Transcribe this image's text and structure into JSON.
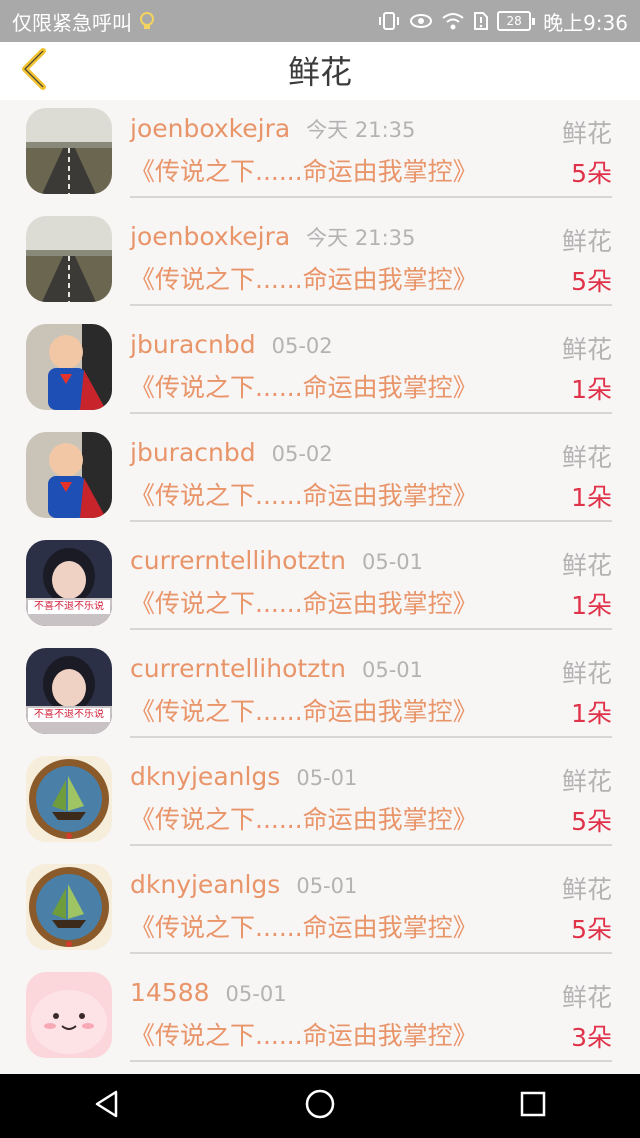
{
  "status_bar": {
    "carrier": "仅限紧急呼叫",
    "battery": "28",
    "time": "晚上9:36",
    "icons": [
      "lightbulb-icon",
      "vibrate-icon",
      "eye-icon",
      "wifi-icon",
      "sim-alert-icon",
      "battery-icon"
    ]
  },
  "header": {
    "title": "鲜花",
    "back_icon": "chevron-left-icon",
    "accent": "#f2c12e"
  },
  "colors": {
    "username": "#e9956a",
    "meta": "#b3b3b3",
    "count": "#e0334a"
  },
  "items": [
    {
      "user": "joenboxkejra",
      "time": "今天 21:35",
      "label": "鲜花",
      "book": "《传说之下......命运由我掌控》",
      "count": "5朵",
      "avatar": "road-photo"
    },
    {
      "user": "joenboxkejra",
      "time": "今天 21:35",
      "label": "鲜花",
      "book": "《传说之下......命运由我掌控》",
      "count": "5朵",
      "avatar": "road-photo"
    },
    {
      "user": "jburacnbd",
      "time": "05-02",
      "label": "鲜花",
      "book": "《传说之下......命运由我掌控》",
      "count": "1朵",
      "avatar": "superman-baby-photo"
    },
    {
      "user": "jburacnbd",
      "time": "05-02",
      "label": "鲜花",
      "book": "《传说之下......命运由我掌控》",
      "count": "1朵",
      "avatar": "superman-baby-photo"
    },
    {
      "user": "currerntellihotztn",
      "time": "05-01",
      "label": "鲜花",
      "book": "《传说之下......命运由我掌控》",
      "count": "1朵",
      "avatar": "girl-photo"
    },
    {
      "user": "currerntellihotztn",
      "time": "05-01",
      "label": "鲜花",
      "book": "《传说之下......命运由我掌控》",
      "count": "1朵",
      "avatar": "girl-photo"
    },
    {
      "user": "dknyjeanlgs",
      "time": "05-01",
      "label": "鲜花",
      "book": "《传说之下......命运由我掌控》",
      "count": "5朵",
      "avatar": "ship-compass-image"
    },
    {
      "user": "dknyjeanlgs",
      "time": "05-01",
      "label": "鲜花",
      "book": "《传说之下......命运由我掌控》",
      "count": "5朵",
      "avatar": "ship-compass-image"
    },
    {
      "user": "14588",
      "time": "05-01",
      "label": "鲜花",
      "book": "《传说之下......命运由我掌控》",
      "count": "3朵",
      "avatar": "pink-cartoon-image"
    }
  ],
  "avatar_caption": "不喜不退不乐说",
  "nav": {
    "icons": [
      "back-triangle-icon",
      "home-circle-icon",
      "recents-square-icon"
    ]
  }
}
